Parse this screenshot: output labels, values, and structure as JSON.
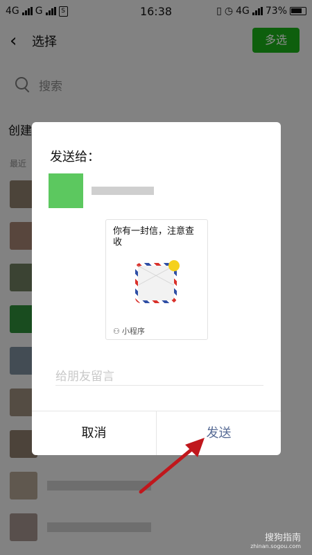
{
  "status_bar": {
    "left_network_1": "4G",
    "left_network_2": "G",
    "time": "16:38",
    "right_network": "4G",
    "battery_percent": "73%"
  },
  "header": {
    "back_icon": "chevron-left-icon",
    "title": "选择",
    "multi_select_label": "多选",
    "accent": "#1aad19"
  },
  "search": {
    "placeholder": "搜索",
    "icon": "search-icon"
  },
  "create_row": {
    "label": "创建"
  },
  "recent_label": "最近",
  "chat_rows": [
    {
      "avatar_color": "#8a7d6a"
    },
    {
      "avatar_color": "#a08070"
    },
    {
      "avatar_color": "#6c7a5e"
    },
    {
      "avatar_color": "#2e8b3a"
    },
    {
      "avatar_color": "#7a8a9a"
    },
    {
      "avatar_color": "#9a8a7a"
    },
    {
      "avatar_color": "#8a7a6a"
    },
    {
      "avatar_color": "#b0a090"
    },
    {
      "avatar_color": "#a0908a"
    }
  ],
  "dialog": {
    "title": "发送给：",
    "card": {
      "text": "你有一封信，注意查收",
      "icon": "envelope-icon",
      "footer_icon": "link-icon",
      "footer_label": "小程序"
    },
    "message_placeholder": "给朋友留言",
    "cancel_label": "取消",
    "send_label": "发送",
    "send_color": "#576b95"
  },
  "annotation": {
    "arrow_color": "#c0171c"
  },
  "watermark": {
    "text": "搜狗指南",
    "sub": "zhinan.sogou.com"
  }
}
